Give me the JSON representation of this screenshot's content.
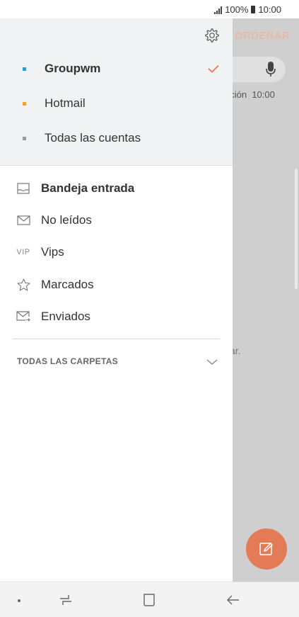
{
  "status": {
    "battery_pct": "100%",
    "time": "10:00"
  },
  "background_app": {
    "sort_label": "ORDENAR",
    "snippet": "ación",
    "snippet_time": "10:00",
    "empty_hint": "ltar."
  },
  "drawer": {
    "accounts": [
      {
        "label": "Groupwm",
        "dot_color": "#2a9bd6",
        "selected": true
      },
      {
        "label": "Hotmail",
        "dot_color": "#f0a030",
        "selected": false
      },
      {
        "label": "Todas las cuentas",
        "dot_color": "#9a9a9a",
        "selected": false
      }
    ],
    "folders": [
      {
        "label": "Bandeja entrada",
        "icon": "inbox-icon"
      },
      {
        "label": "No leídos",
        "icon": "envelope-icon"
      },
      {
        "label": "Vips",
        "icon": "vip-icon",
        "icon_text": "VIP"
      },
      {
        "label": "Marcados",
        "icon": "star-icon"
      },
      {
        "label": "Enviados",
        "icon": "sent-envelope-icon"
      }
    ],
    "all_folders_label": "TODAS LAS CARPETAS"
  },
  "colors": {
    "accent": "#e27b56",
    "drawer_header_bg": "#f1f2f4"
  }
}
